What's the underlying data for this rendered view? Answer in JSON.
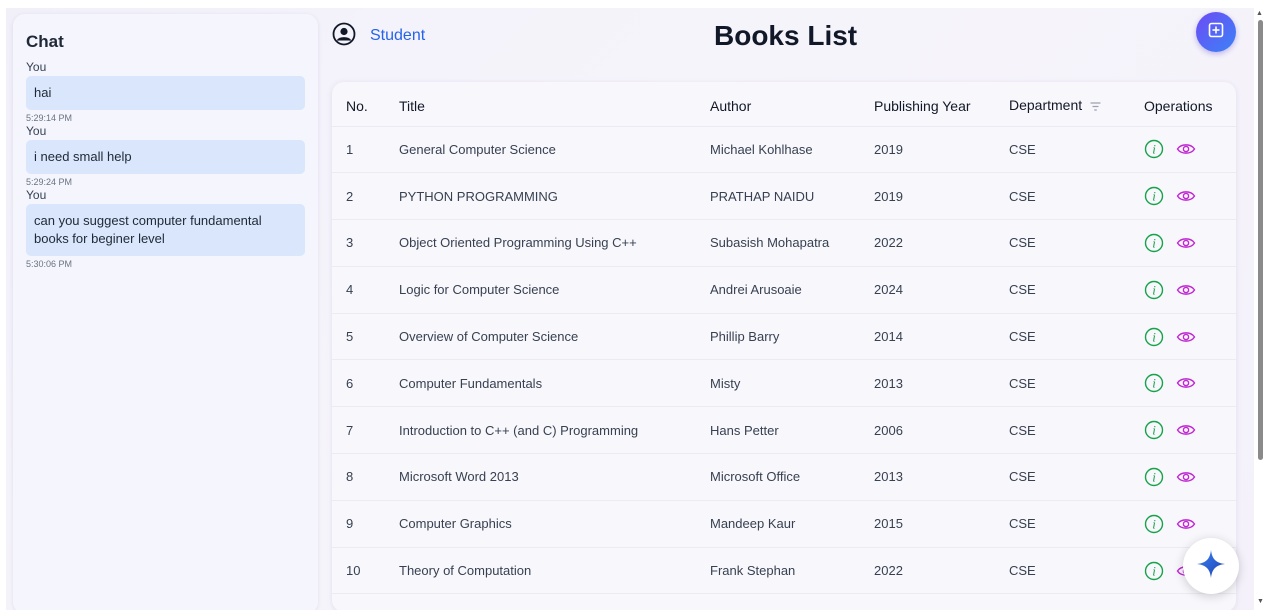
{
  "chat": {
    "title": "Chat",
    "messages": [
      {
        "sender": "You",
        "text": "hai",
        "time": "5:29:14 PM"
      },
      {
        "sender": "You",
        "text": "i need small help",
        "time": "5:29:24 PM"
      },
      {
        "sender": "You",
        "text": "can you suggest computer fundamental books for beginer level",
        "time": "5:30:06 PM"
      }
    ]
  },
  "header": {
    "user_label": "Student",
    "title": "Books List",
    "add_icon": "add-box-icon"
  },
  "table": {
    "columns": [
      "No.",
      "Title",
      "Author",
      "Publishing Year",
      "Department",
      "Operations"
    ],
    "rows": [
      {
        "no": "1",
        "title": "General Computer Science",
        "author": "Michael Kohlhase",
        "year": "2019",
        "dept": "CSE"
      },
      {
        "no": "2",
        "title": "PYTHON PROGRAMMING",
        "author": "PRATHAP NAIDU",
        "year": "2019",
        "dept": "CSE"
      },
      {
        "no": "3",
        "title": "Object Oriented Programming Using C++",
        "author": "Subasish Mohapatra",
        "year": "2022",
        "dept": "CSE"
      },
      {
        "no": "4",
        "title": "Logic for Computer Science",
        "author": "Andrei Arusoaie",
        "year": "2024",
        "dept": "CSE"
      },
      {
        "no": "5",
        "title": "Overview of Computer Science",
        "author": "Phillip Barry",
        "year": "2014",
        "dept": "CSE"
      },
      {
        "no": "6",
        "title": "Computer Fundamentals",
        "author": "Misty",
        "year": "2013",
        "dept": "CSE"
      },
      {
        "no": "7",
        "title": "Introduction to C++ (and C) Programming",
        "author": "Hans Petter",
        "year": "2006",
        "dept": "CSE"
      },
      {
        "no": "8",
        "title": "Microsoft Word 2013",
        "author": "Microsoft Office",
        "year": "2013",
        "dept": "CSE"
      },
      {
        "no": "9",
        "title": "Computer Graphics",
        "author": "Mandeep Kaur",
        "year": "2015",
        "dept": "CSE"
      },
      {
        "no": "10",
        "title": "Theory of Computation",
        "author": "Frank Stephan",
        "year": "2022",
        "dept": "CSE"
      }
    ]
  },
  "colors": {
    "accent_blue": "#2563eb",
    "info_green": "#16a34a",
    "view_purple": "#c026d3",
    "bubble_bg": "#d9e6fb"
  },
  "icons": {
    "user": "user-circle-icon",
    "filter": "filter-icon",
    "info": "info-icon",
    "view": "eye-icon",
    "assistant": "sparkle-icon"
  }
}
